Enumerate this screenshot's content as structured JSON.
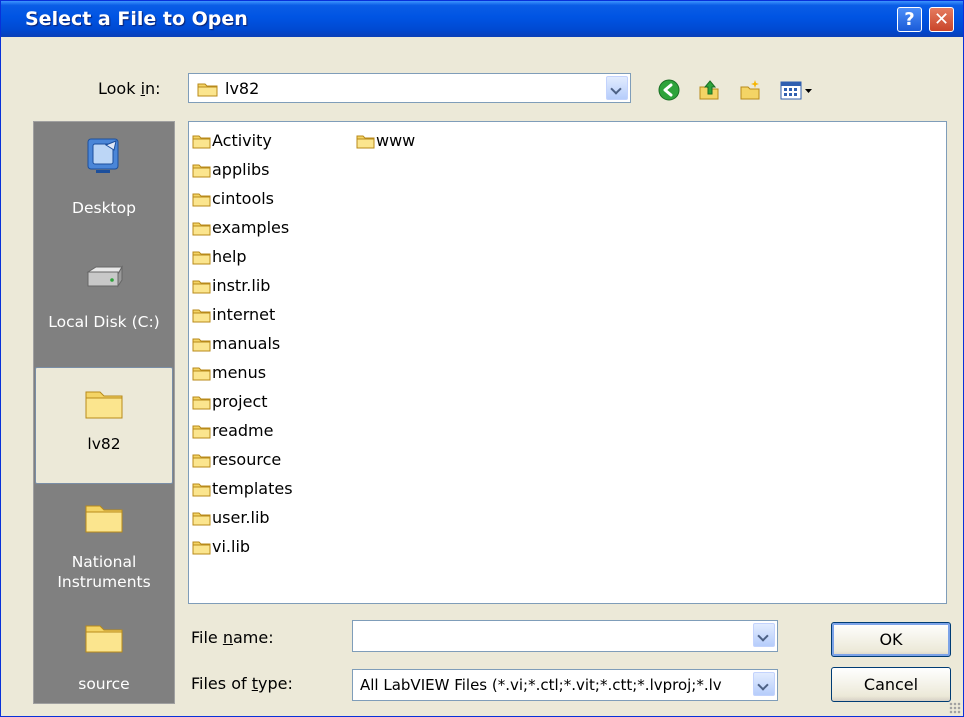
{
  "window": {
    "title": "Select a File to Open",
    "help_glyph": "?",
    "close_glyph": "✕"
  },
  "look_in": {
    "label_prefix": "Look ",
    "label_mnemonic": "i",
    "label_suffix": "n:",
    "value": "lv82"
  },
  "toolbar": {
    "icons": [
      "back-icon",
      "up-folder-icon",
      "new-folder-icon",
      "views-menu-icon"
    ]
  },
  "places": [
    {
      "label": "Desktop",
      "icon": "desktop-icon"
    },
    {
      "label": "Local Disk (C:)",
      "icon": "hard-drive-icon"
    },
    {
      "label": "lv82",
      "icon": "folder-icon",
      "selected": true
    },
    {
      "label": "National Instruments",
      "icon": "folder-icon"
    },
    {
      "label": "source",
      "icon": "folder-icon"
    }
  ],
  "files": {
    "column1": [
      "Activity",
      "applibs",
      "cintools",
      "examples",
      "help",
      "instr.lib",
      "internet",
      "manuals",
      "menus",
      "project",
      "readme",
      "resource",
      "templates",
      "user.lib",
      "vi.lib"
    ],
    "column2": [
      "www"
    ]
  },
  "file_name": {
    "label_prefix": "File ",
    "label_mnemonic": "n",
    "label_suffix": "ame:",
    "value": ""
  },
  "file_type": {
    "label_prefix": "Files of ",
    "label_mnemonic": "t",
    "label_suffix": "ype:",
    "value": "All LabVIEW Files (*.vi;*.ctl;*.vit;*.ctt;*.lvproj;*.lv"
  },
  "buttons": {
    "ok": "OK",
    "cancel": "Cancel"
  },
  "colors": {
    "title_bar": "#0054e3",
    "dialog_bg": "#ece9d8",
    "places_bg": "#808080",
    "folder": "#f4d465"
  }
}
